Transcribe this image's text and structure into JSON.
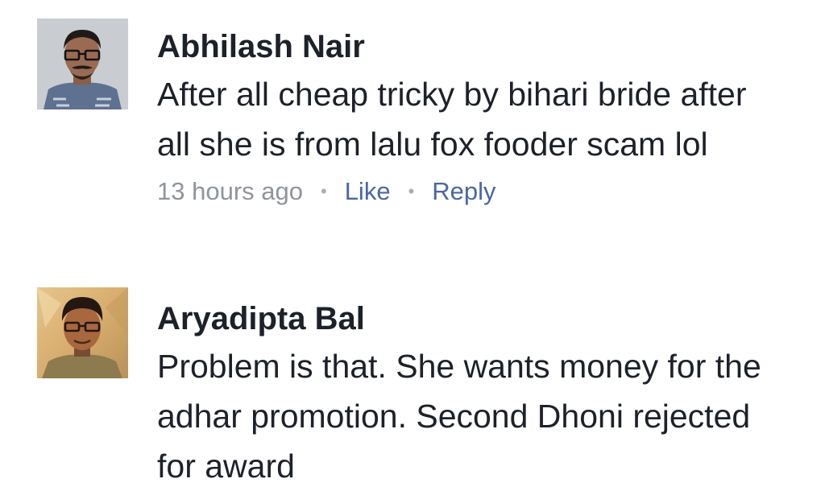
{
  "comments": [
    {
      "author": "Abhilash Nair",
      "text": "After all cheap tricky by bihari bride after all she is from lalu fox fooder scam lol",
      "time": "13 hours ago",
      "like_label": "Like",
      "reply_label": "Reply"
    },
    {
      "author": "Aryadipta Bal",
      "text": "Problem is that. She wants money for the adhar promotion. Second Dhoni rejected for award"
    }
  ],
  "colors": {
    "text": "#1d2129",
    "meta": "#90949c",
    "link": "#4b67a1"
  }
}
